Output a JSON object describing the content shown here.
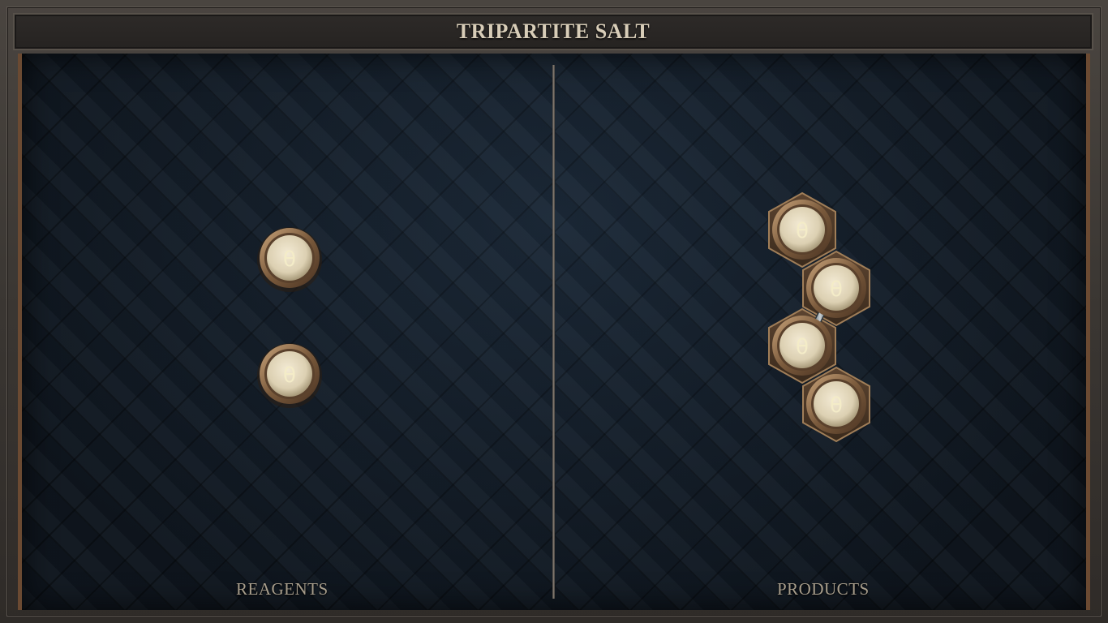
{
  "puzzle": {
    "title": "TRIPARTITE SALT"
  },
  "reagents": {
    "label": "REAGENTS",
    "atoms": [
      {
        "symbol": "θ",
        "element": "salt"
      },
      {
        "symbol": "θ",
        "element": "salt"
      }
    ]
  },
  "products": {
    "label": "PRODUCTS",
    "atoms": [
      {
        "symbol": "θ",
        "element": "salt"
      },
      {
        "symbol": "θ",
        "element": "salt"
      },
      {
        "symbol": "θ",
        "element": "salt"
      },
      {
        "symbol": "θ",
        "element": "salt"
      }
    ],
    "bonds": [
      [
        1,
        2
      ]
    ]
  },
  "colors": {
    "board": "#17222f",
    "frame": "#3a3531",
    "atom_fill": "#e6dcc0",
    "bronze": "#8a6a48",
    "glyph": "#f4ecc8"
  }
}
